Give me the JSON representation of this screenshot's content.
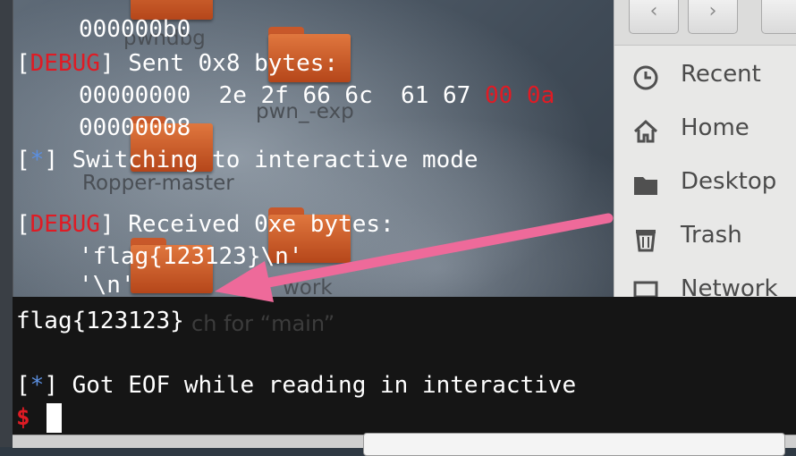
{
  "desktop": {
    "icons": [
      {
        "label": "pwndbg"
      },
      {
        "label": "pwn_-exp"
      },
      {
        "label": "Ropper-master"
      },
      {
        "label": "work"
      }
    ]
  },
  "file_manager": {
    "nav": {
      "back_icon": "chevron-left-icon",
      "forward_icon": "chevron-right-icon"
    },
    "places": [
      {
        "label": "Recent",
        "icon": "clock-icon"
      },
      {
        "label": "Home",
        "icon": "home-icon"
      },
      {
        "label": "Desktop",
        "icon": "folder-icon"
      },
      {
        "label": "Trash",
        "icon": "trash-icon"
      },
      {
        "label": "Network",
        "icon": "network-icon"
      }
    ],
    "search_hint": "ch for “main”"
  },
  "terminal": {
    "hexdump_prev_offset": "000000b0",
    "debug_tag": "DEBUG",
    "star_tag": "*",
    "sent_msg": "Sent 0x8 bytes:",
    "hex_offset_0": "00000000",
    "hex_bytes_plain": "2e 2f 66 6c  61 67",
    "hex_bytes_red": "00 0a",
    "hex_offset_8": "00000008",
    "switching_msg": "Switching to interactive mode",
    "received_msg": "Received 0xe bytes:",
    "recv_line_1": "'flag{123123}\\n'",
    "recv_line_2": "'\\n'",
    "flag_output": "flag{123123}",
    "eof_msg": "Got EOF while reading in interactive",
    "prompt": "$"
  },
  "colors": {
    "debug_red": "#e01b24",
    "star_blue": "#5b8fe0",
    "arrow_pink": "#ee6a9a",
    "terminal_bg": "#151515"
  }
}
